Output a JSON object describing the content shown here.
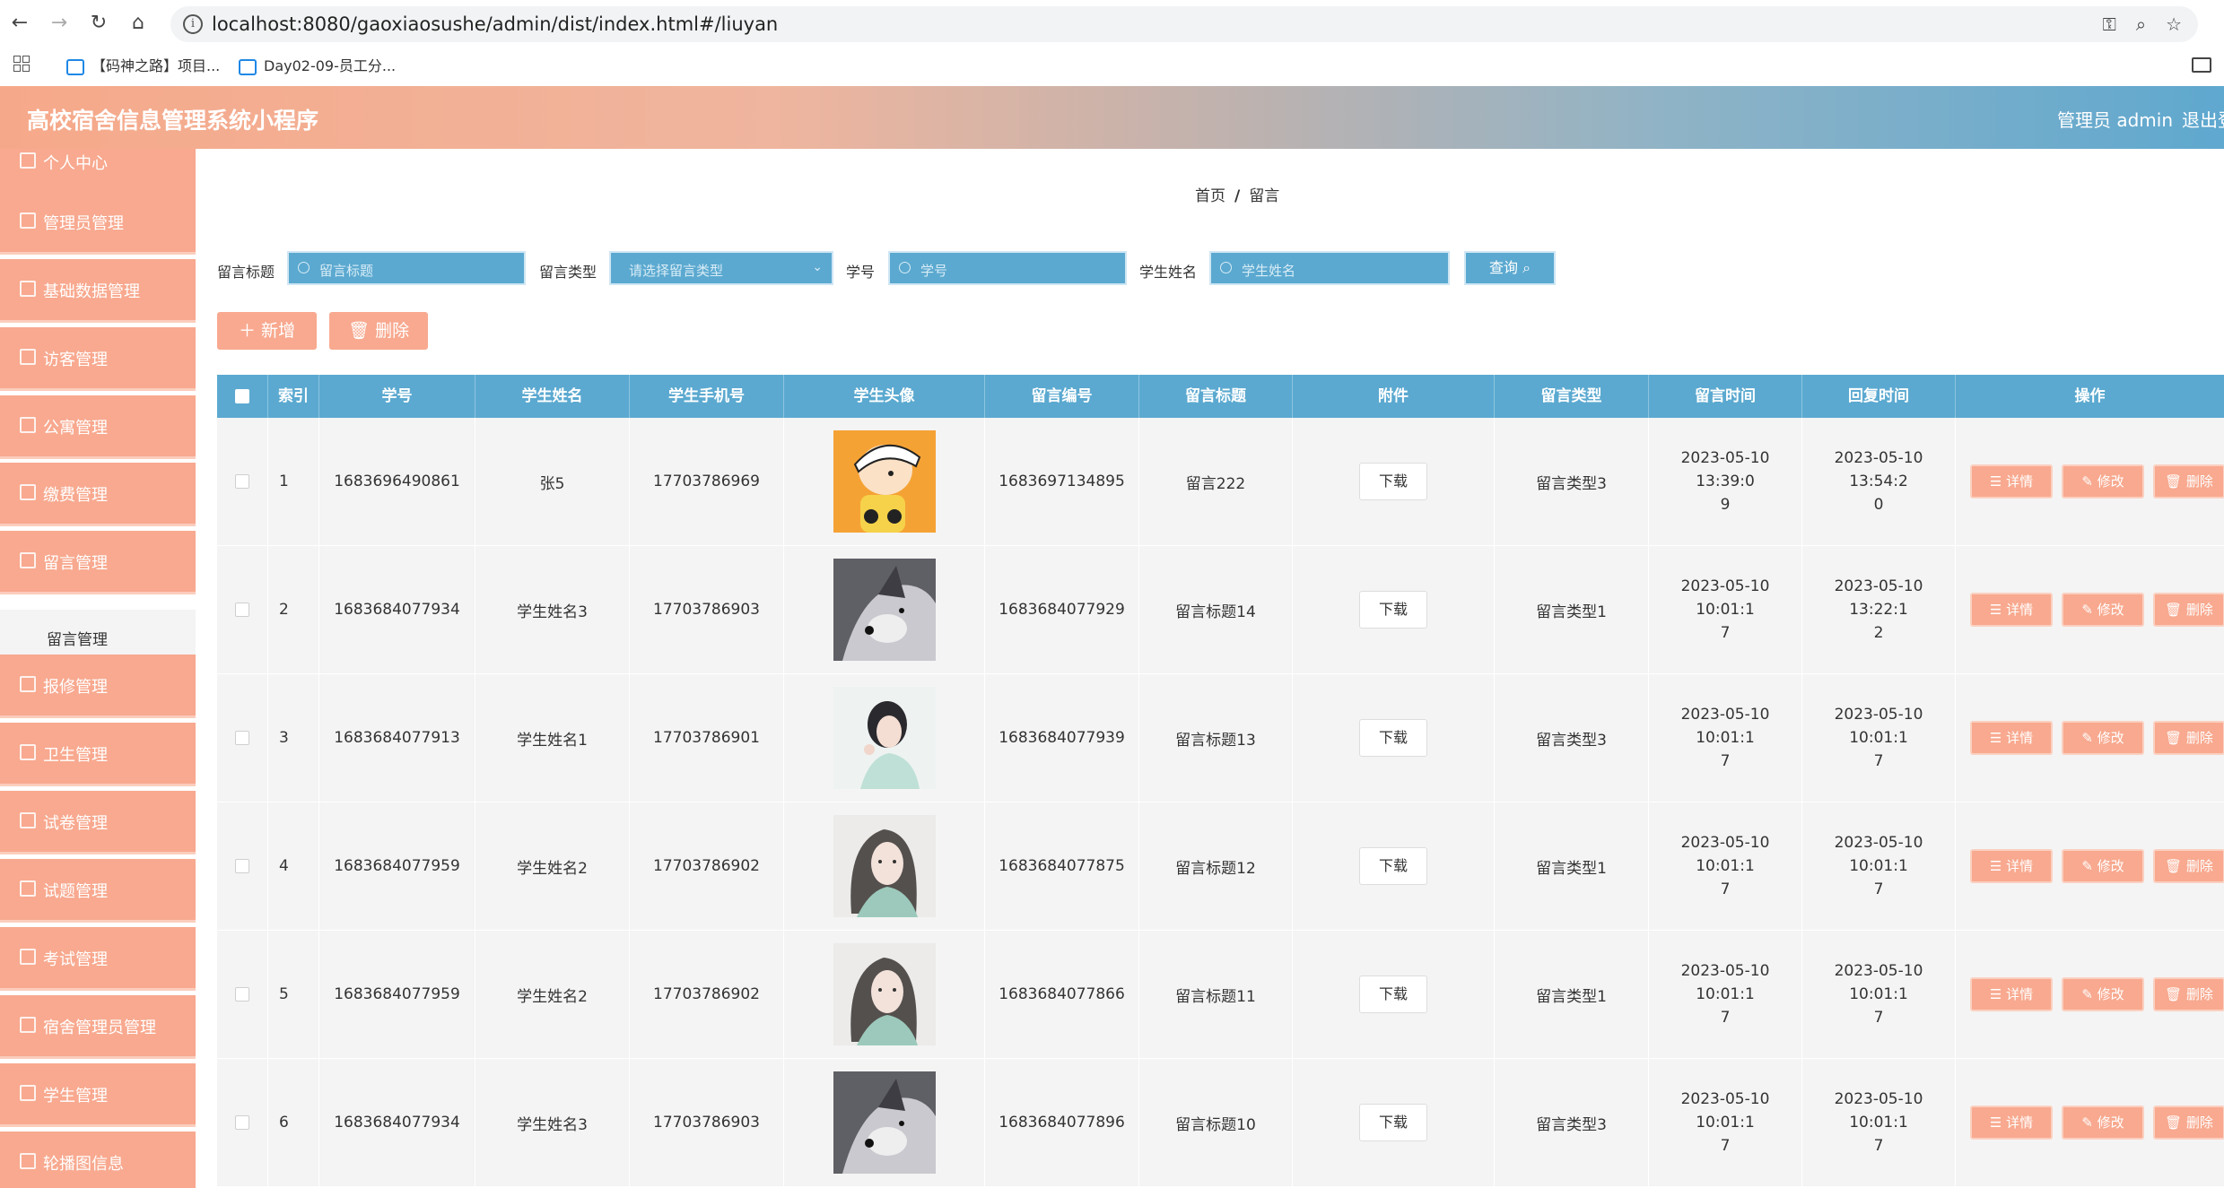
{
  "browser": {
    "url": "localhost:8080/gaoxiaosushe/admin/dist/index.html#/liuyan",
    "bookmarks": [
      "【码神之路】项目...",
      "Day02-09-员工分..."
    ]
  },
  "app": {
    "title": "高校宿舍信息管理系统小程序",
    "admin_label": "管理员 admin",
    "logout": "退出登录"
  },
  "sidebar": {
    "items": [
      {
        "label": "个人中心",
        "icon": "person-icon"
      },
      {
        "label": "管理员管理",
        "icon": "grid-icon"
      },
      {
        "label": "基础数据管理",
        "icon": "grid-icon"
      },
      {
        "label": "访客管理",
        "icon": "grid-icon"
      },
      {
        "label": "公寓管理",
        "icon": "grid-icon"
      },
      {
        "label": "缴费管理",
        "icon": "grid-icon"
      },
      {
        "label": "留言管理",
        "icon": "grid-icon"
      },
      {
        "label": "报修管理",
        "icon": "pin-icon"
      },
      {
        "label": "卫生管理",
        "icon": "grid-icon"
      },
      {
        "label": "试卷管理",
        "icon": "grid-icon"
      },
      {
        "label": "试题管理",
        "icon": "grid-icon"
      },
      {
        "label": "考试管理",
        "icon": "person-icon"
      },
      {
        "label": "宿舍管理员管理",
        "icon": "grid-icon"
      },
      {
        "label": "学生管理",
        "icon": "grid-icon"
      },
      {
        "label": "轮播图信息",
        "icon": "grid-icon"
      }
    ],
    "active_sub": "留言管理"
  },
  "breadcrumb": {
    "home": "首页",
    "sep": "/",
    "current": "留言"
  },
  "filters": {
    "title_label": "留言标题",
    "title_ph": "留言标题",
    "type_label": "留言类型",
    "type_ph": "请选择留言类型",
    "sno_label": "学号",
    "sno_ph": "学号",
    "name_label": "学生姓名",
    "name_ph": "学生姓名",
    "query": "查询"
  },
  "actions": {
    "add": "新增",
    "delete": "删除"
  },
  "table": {
    "headers": [
      "索引",
      "学号",
      "学生姓名",
      "学生手机号",
      "学生头像",
      "留言编号",
      "留言标题",
      "附件",
      "留言类型",
      "留言时间",
      "回复时间",
      "操作"
    ],
    "download": "下载",
    "op_detail": "详情",
    "op_edit": "修改",
    "op_delete": "删除",
    "rows": [
      {
        "idx": "1",
        "sno": "1683696490861",
        "name": "张5",
        "phone": "17703786969",
        "avatar": "cartoon",
        "msgno": "1683697134895",
        "title": "留言222",
        "type": "留言类型3",
        "time1": "2023-05-10 13:39:0",
        "time2": "9",
        "reply1": "2023-05-10 13:54:2",
        "reply2": "0"
      },
      {
        "idx": "2",
        "sno": "1683684077934",
        "name": "学生姓名3",
        "phone": "17703786903",
        "avatar": "dog",
        "msgno": "1683684077929",
        "title": "留言标题14",
        "type": "留言类型1",
        "time1": "2023-05-10 10:01:1",
        "time2": "7",
        "reply1": "2023-05-10 13:22:1",
        "reply2": "2"
      },
      {
        "idx": "3",
        "sno": "1683684077913",
        "name": "学生姓名1",
        "phone": "17703786901",
        "avatar": "girl1",
        "msgno": "1683684077939",
        "title": "留言标题13",
        "type": "留言类型3",
        "time1": "2023-05-10 10:01:1",
        "time2": "7",
        "reply1": "2023-05-10 10:01:1",
        "reply2": "7"
      },
      {
        "idx": "4",
        "sno": "1683684077959",
        "name": "学生姓名2",
        "phone": "17703786902",
        "avatar": "girl2",
        "msgno": "1683684077875",
        "title": "留言标题12",
        "type": "留言类型1",
        "time1": "2023-05-10 10:01:1",
        "time2": "7",
        "reply1": "2023-05-10 10:01:1",
        "reply2": "7"
      },
      {
        "idx": "5",
        "sno": "1683684077959",
        "name": "学生姓名2",
        "phone": "17703786902",
        "avatar": "girl2",
        "msgno": "1683684077866",
        "title": "留言标题11",
        "type": "留言类型1",
        "time1": "2023-05-10 10:01:1",
        "time2": "7",
        "reply1": "2023-05-10 10:01:1",
        "reply2": "7"
      },
      {
        "idx": "6",
        "sno": "1683684077934",
        "name": "学生姓名3",
        "phone": "17703786903",
        "avatar": "dog",
        "msgno": "1683684077896",
        "title": "留言标题10",
        "type": "留言类型3",
        "time1": "2023-05-10 10:01:1",
        "time2": "7",
        "reply1": "2023-05-10 10:01:1",
        "reply2": "7"
      }
    ]
  }
}
